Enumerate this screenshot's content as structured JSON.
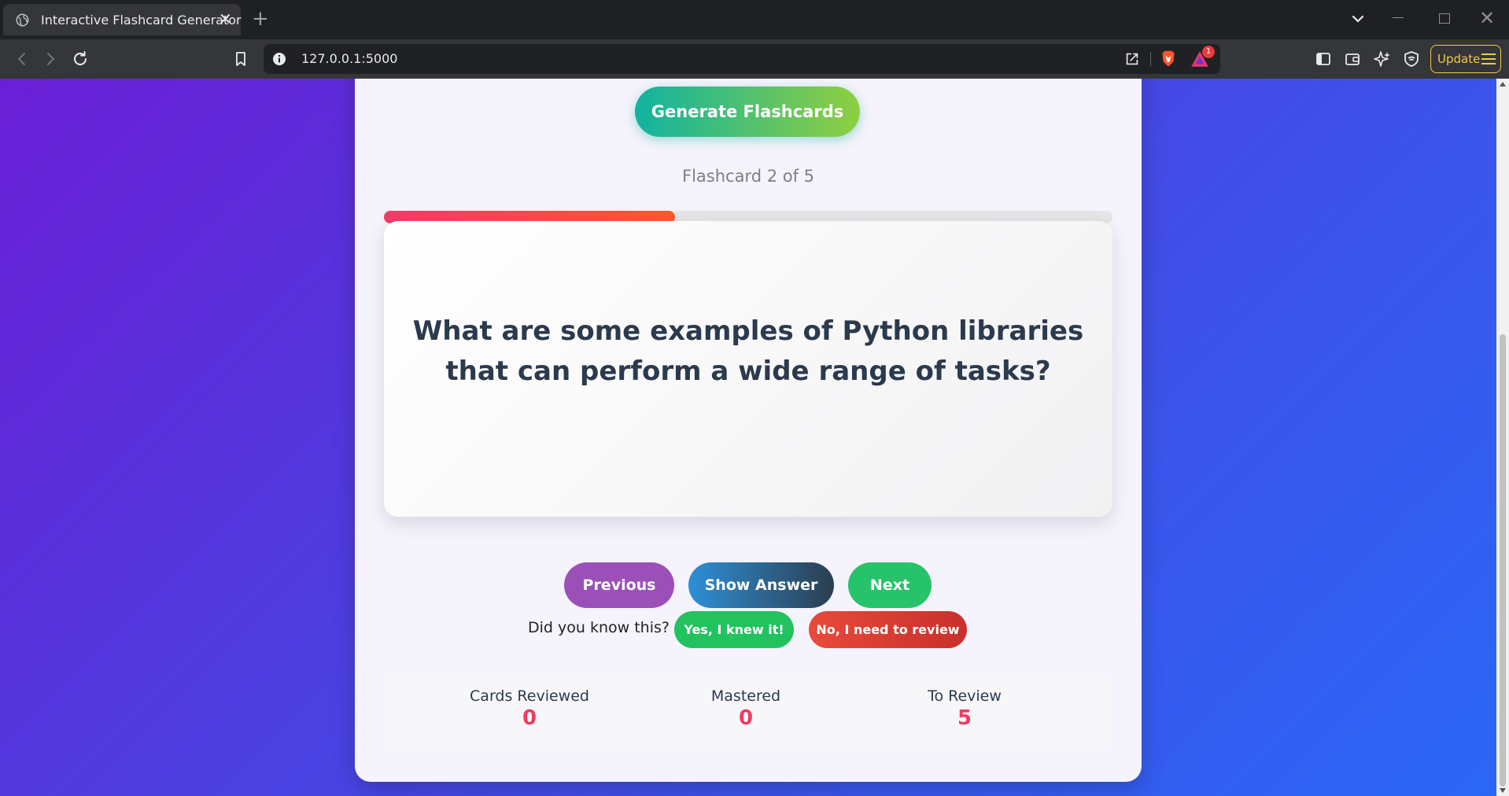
{
  "browser": {
    "tab_title": "Interactive Flashcard Generator",
    "tab_close": "✕",
    "new_tab": "+",
    "url": "127.0.0.1:5000",
    "rewards_badge": "1",
    "update_label": "Update"
  },
  "app": {
    "generate_label": "Generate Flashcards",
    "counter_text": "Flashcard 2 of 5",
    "progress_fraction": 0.4,
    "question": "What are some examples of Python libraries that can perform a wide range of tasks?",
    "buttons": {
      "previous": "Previous",
      "show_answer": "Show Answer",
      "next": "Next"
    },
    "feedback": {
      "prompt": "Did you know this?",
      "yes": "Yes, I knew it!",
      "no": "No, I need to review"
    },
    "stats": {
      "reviewed_label": "Cards Reviewed",
      "reviewed_value": "0",
      "mastered_label": "Mastered",
      "mastered_value": "0",
      "review_label": "To Review",
      "review_value": "5"
    }
  }
}
